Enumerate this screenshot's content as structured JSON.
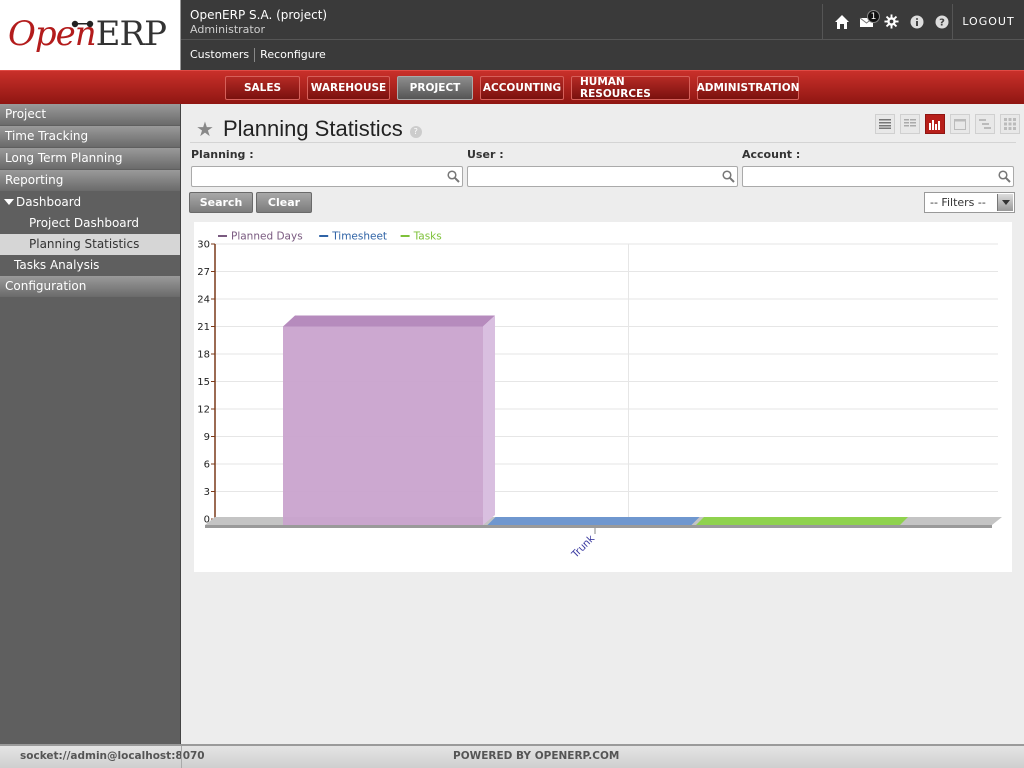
{
  "header": {
    "logo_open": "Open",
    "logo_erp": "ERP",
    "company": "OpenERP S.A. (project)",
    "user": "Administrator",
    "shortcuts": [
      "Customers",
      "Reconfigure"
    ],
    "messages_badge": "1",
    "logout_label": "LOGOUT"
  },
  "menus": [
    {
      "label": "SALES",
      "active": false
    },
    {
      "label": "WAREHOUSE",
      "active": false
    },
    {
      "label": "PROJECT",
      "active": true
    },
    {
      "label": "ACCOUNTING",
      "active": false
    },
    {
      "label": "HUMAN RESOURCES",
      "active": false
    },
    {
      "label": "ADMINISTRATION",
      "active": false
    }
  ],
  "sidebar": {
    "sections": [
      "Project",
      "Time Tracking",
      "Long Term Planning",
      "Reporting"
    ],
    "dashboard": "Dashboard",
    "dashboard_items": [
      "Project Dashboard",
      "Planning Statistics"
    ],
    "selected": "Planning Statistics",
    "tasks_analysis": "Tasks Analysis",
    "configuration": "Configuration"
  },
  "main": {
    "title": "Planning Statistics",
    "help": "?",
    "fields": {
      "planning_label": "Planning :",
      "planning_value": "",
      "user_label": "User :",
      "user_value": "",
      "account_label": "Account :",
      "account_value": ""
    },
    "search_label": "Search",
    "clear_label": "Clear",
    "filters_value": "-- Filters --",
    "active_view": "graph"
  },
  "chart_data": {
    "type": "bar",
    "categories": [
      "Trunk"
    ],
    "series": [
      {
        "name": "Planned Days",
        "values": [
          21
        ],
        "color": "#c9a3ce"
      },
      {
        "name": "Timesheet",
        "values": [
          0
        ],
        "color": "#6f97cf"
      },
      {
        "name": "Tasks",
        "values": [
          0
        ],
        "color": "#8fd24e"
      }
    ],
    "legend_colors": [
      "#7a5a80",
      "#2f63a6",
      "#7ec13a"
    ],
    "legend_placement": "top-left",
    "ylim": [
      0,
      30
    ],
    "yticks": [
      0,
      3,
      6,
      9,
      12,
      15,
      18,
      21,
      24,
      27,
      30
    ],
    "grid": true
  },
  "footer": {
    "socket": "socket://admin@localhost:8070",
    "powered": "POWERED BY OPENERP.COM"
  }
}
